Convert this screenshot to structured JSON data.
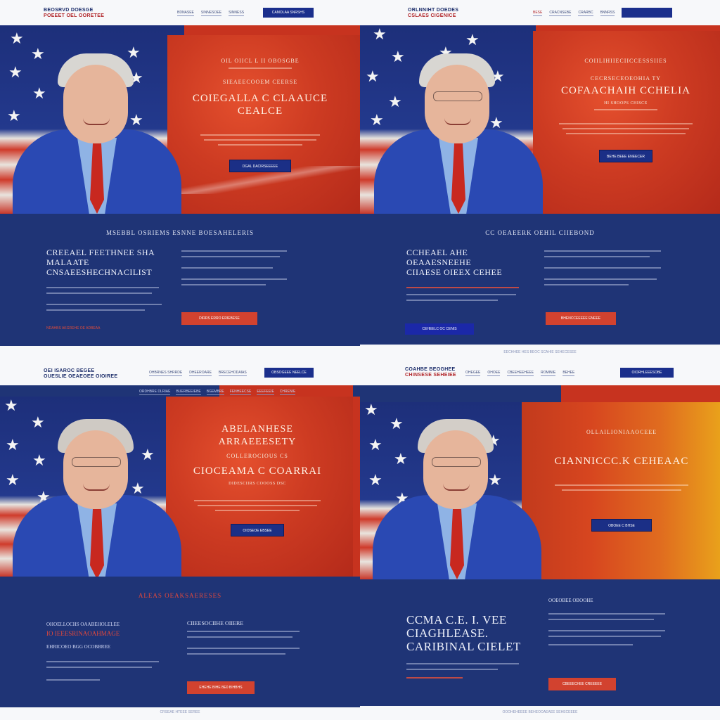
{
  "panels": [
    {
      "logo_line1": "BEOSRVD DOESGE",
      "logo_line2": "POEEET OEL OORETEE",
      "nav": [
        "BDNASEE",
        "SINNESOEE",
        "SINNESS"
      ],
      "nav_button": "CAMOLAA SNRSHS",
      "hero_kicker": "OIL OIICL L II OBOSGBE",
      "hero_sub1": "SIEAEECOOEM CEERSE",
      "hero_title": "COIEGALLA C CLAAUCE",
      "hero_title2": "CEALCE",
      "hero_cta": "DGAL DACIRSEEEEE",
      "lower_title": "MSEBBL OSRIEMS ESNNE BOESAHELERIS",
      "left_big": "CREEAEL FEETHNEE SHA MALAATE",
      "left_big2": "CNSAEESHECHNACILIST",
      "red_button": "DIRRS ERRO ERIEBESE",
      "red_link": "NDAHBS AKGREHE OE ADBEAA",
      "footer": ""
    },
    {
      "logo_line1": "ORLNNIHT DOEDES",
      "logo_line2": "CSLAES CIGENICE",
      "nav": [
        "BESE",
        "CRACNSEBE",
        "CRARBC",
        "BNNRSS"
      ],
      "nav_button": "",
      "hero_kicker": "COIILIHIIECIICCESSSIIES",
      "hero_sub1": "CECRSECEOEOHIA TY",
      "hero_title": "COFAACHAIH CCHELIA",
      "hero_sub2": "HI SHOOPS CHISCE",
      "hero_cta": "BEHE BEEE ENEECER",
      "lower_title": "CC OEAEERK OEHIL CIIEBOND",
      "left_big": "CCHEAEL AHE OEAAESNEEHE",
      "left_big2": "CIIAESE OIEEX CEHEE",
      "blue_button": "CEHEELC OC CENIS",
      "red_button": "BHENCCEEEEE ENEEE",
      "footer": "EECHHEE HES BEOC SCAHIE SEHECESEE"
    },
    {
      "logo_line1": "OEI ISAROC BEGEE",
      "logo_line2": "OUESLIE OEAEOEE OIOIREE",
      "nav": [
        "OHBRNES SHRRDE",
        "DHEEROARE",
        "BRECEHODAIAS"
      ],
      "nav_button": "OBSOGEEE NEELCE",
      "subnav": [
        "ORDHBRE DLRIAE",
        "BUERBEEIEBE",
        "BGEMBRE",
        "FENHEECSE",
        "EEEFEEIE",
        "CHRENIE"
      ],
      "hero_kicker": "ABELANHESE",
      "hero_sub1": "ARRAEEESETY",
      "hero_sub2": "COLLEROCIOUS CS",
      "hero_title": "CIOCEAMA C COARRAI",
      "hero_sub3": "DIDESCIIRS COOOSS DSC",
      "hero_cta": "OIOSEOE EBSEE",
      "lower_title": "ALEAS OEAKSAERESES",
      "left_big": "OHOELLOCHS OAABEHOLELEE",
      "left_big2": "IO IEEESRINAOAHMAGE",
      "left_small": "EHRICOEO BGG OCOBBREE",
      "right_head": "CIIEESOCIIHE OIIERE",
      "red_button": "EHEHE BIHE BE0 BIHBHS",
      "footer": "CRSEAE HTEEE SEREE"
    },
    {
      "logo_line1": "COAHBE BEOGHEE",
      "logo_line2": "CHINSESE SEHEIEE",
      "nav": [
        "OHEGEE",
        "OHOEE",
        "CBEEHEEHEEE",
        "ROMINIE",
        "BEHEE"
      ],
      "nav_button": "OIORHLEEESOBE",
      "hero_kicker": "OLLAILIONIAAOCEEE",
      "hero_title": "CIANNICCC.K CEHEAAC",
      "hero_cta": "OBOEE C BHSE",
      "lower_title": "",
      "left_big": "CCMA C.E. I. VEE",
      "left_big2": "CIAGHLEASE.",
      "left_big3": "CARIBINAL CIELET",
      "right_head": "OOEOBEE OBOOHE",
      "red_button": "CBEEECHEE CREEEEE",
      "footer": "OOOHEHEEEE BEHEOOAEAEE SEHECEEEE"
    }
  ]
}
